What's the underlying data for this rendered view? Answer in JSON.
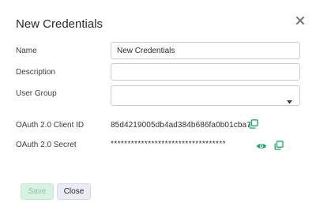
{
  "dialog": {
    "title": "New Credentials"
  },
  "form": {
    "name_label": "Name",
    "name_value": "New Credentials",
    "description_label": "Description",
    "description_value": "",
    "user_group_label": "User Group",
    "user_group_value": "",
    "client_id_label": "OAuth 2.0 Client ID",
    "client_id_value": "85d4219005db4ad384b686fa0b01cba7",
    "secret_label": "OAuth 2.0 Secret",
    "secret_value": "**********************************"
  },
  "buttons": {
    "save_label": "Save",
    "close_label": "Close"
  },
  "icons": {
    "close": "close-icon",
    "dropdown": "chevron-down-icon",
    "copy": "copy-icon",
    "show": "eye-icon"
  },
  "colors": {
    "accent": "#1fa463",
    "save_bg": "#d9f1e3",
    "close_bg": "#e9ecf3"
  }
}
